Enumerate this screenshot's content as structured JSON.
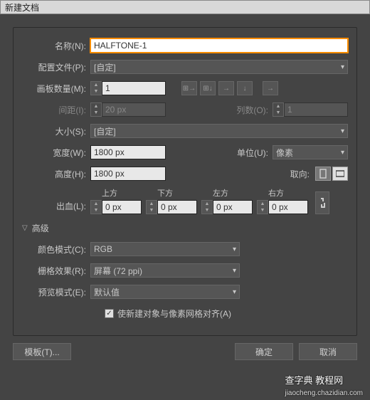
{
  "title": "新建文档",
  "name": {
    "label": "名称(N):",
    "value": "HALFTONE-1"
  },
  "profile": {
    "label": "配置文件(P):",
    "value": "[自定]"
  },
  "artboards": {
    "label": "画板数量(M):",
    "value": "1"
  },
  "spacing": {
    "label": "间距(I):",
    "value": "20 px"
  },
  "columns": {
    "label": "列数(O):",
    "value": "1"
  },
  "size": {
    "label": "大小(S):",
    "value": "[自定]"
  },
  "width": {
    "label": "宽度(W):",
    "value": "1800 px"
  },
  "units": {
    "label": "单位(U):",
    "value": "像素"
  },
  "height": {
    "label": "高度(H):",
    "value": "1800 px"
  },
  "orient": {
    "label": "取向:"
  },
  "bleed": {
    "label": "出血(L):",
    "top": {
      "label": "上方",
      "value": "0 px"
    },
    "bottom": {
      "label": "下方",
      "value": "0 px"
    },
    "left": {
      "label": "左方",
      "value": "0 px"
    },
    "right": {
      "label": "右方",
      "value": "0 px"
    }
  },
  "advanced": "高级",
  "colorMode": {
    "label": "颜色模式(C):",
    "value": "RGB"
  },
  "raster": {
    "label": "栅格效果(R):",
    "value": "屏幕 (72 ppi)"
  },
  "preview": {
    "label": "预览模式(E):",
    "value": "默认值"
  },
  "alignGrid": "使新建对象与像素网格对齐(A)",
  "buttons": {
    "template": "模板(T)...",
    "ok": "确定",
    "cancel": "取消"
  },
  "watermark": {
    "main": "查字典 教程网",
    "sub": "jiaocheng.chazidian.com"
  }
}
